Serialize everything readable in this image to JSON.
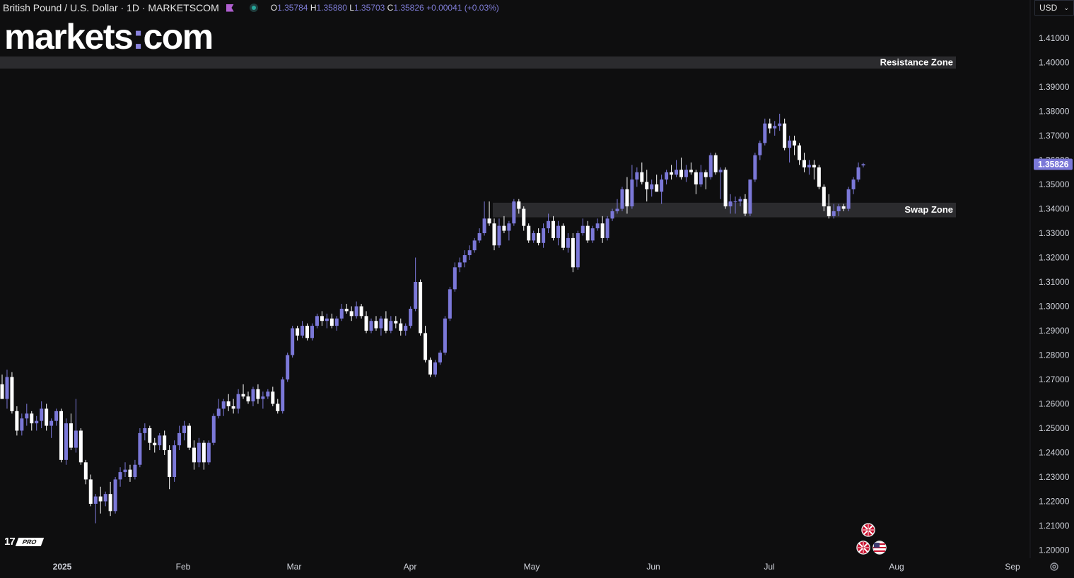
{
  "header": {
    "symbol": "British Pound / U.S. Dollar · 1D · MARKETSCOM",
    "open_label": "O",
    "open": "1.35784",
    "high_label": "H",
    "high": "1.35880",
    "low_label": "L",
    "low": "1.35703",
    "close_label": "C",
    "close": "1.35826",
    "change": "+0.00041 (+0.03%)"
  },
  "logo": {
    "part1": "markets",
    "part2": "com"
  },
  "currency_selector": {
    "value": "USD",
    "icon": "chevron-down-icon"
  },
  "branding": {
    "tv": "17",
    "pro": "PRO"
  },
  "icons": {
    "settings": "gear-icon",
    "flag_uk": "uk-flag-icon",
    "flag_us": "us-flag-icon"
  },
  "colors": {
    "up": "#7b78d8",
    "down": "#ffffff",
    "background": "#0e0e0f",
    "zone": "#2b2b2e",
    "price_tag": "#7b78d8"
  },
  "chart_data": {
    "type": "candlestick",
    "y_ticks": [
      "1.20000",
      "1.21000",
      "1.22000",
      "1.23000",
      "1.24000",
      "1.25000",
      "1.26000",
      "1.27000",
      "1.28000",
      "1.29000",
      "1.30000",
      "1.31000",
      "1.32000",
      "1.33000",
      "1.34000",
      "1.35000",
      "1.36000",
      "1.37000",
      "1.38000",
      "1.39000",
      "1.40000",
      "1.41000"
    ],
    "ylim": [
      1.193,
      1.415
    ],
    "x_labels": [
      "2025",
      "Feb",
      "Mar",
      "Apr",
      "May",
      "Jun",
      "Jul",
      "Aug",
      "Sep"
    ],
    "current_price": "1.35826",
    "zones": [
      {
        "label": "Resistance Zone",
        "low": 1.3975,
        "high": 1.4025
      },
      {
        "label": "Swap Zone",
        "low": 1.3365,
        "high": 1.3425
      }
    ],
    "candles": [
      [
        1.268,
        1.272,
        1.262,
        1.262
      ],
      [
        1.262,
        1.274,
        1.258,
        1.271
      ],
      [
        1.271,
        1.273,
        1.256,
        1.257
      ],
      [
        1.257,
        1.259,
        1.247,
        1.249
      ],
      [
        1.249,
        1.256,
        1.247,
        1.254
      ],
      [
        1.254,
        1.26,
        1.251,
        1.256
      ],
      [
        1.256,
        1.257,
        1.249,
        1.252
      ],
      [
        1.252,
        1.255,
        1.249,
        1.253
      ],
      [
        1.253,
        1.261,
        1.25,
        1.258
      ],
      [
        1.258,
        1.26,
        1.249,
        1.251
      ],
      [
        1.251,
        1.254,
        1.246,
        1.253
      ],
      [
        1.253,
        1.258,
        1.251,
        1.257
      ],
      [
        1.257,
        1.258,
        1.236,
        1.237
      ],
      [
        1.237,
        1.254,
        1.235,
        1.252
      ],
      [
        1.252,
        1.256,
        1.241,
        1.242
      ],
      [
        1.242,
        1.262,
        1.24,
        1.249
      ],
      [
        1.249,
        1.25,
        1.235,
        1.236
      ],
      [
        1.236,
        1.237,
        1.227,
        1.229
      ],
      [
        1.229,
        1.231,
        1.218,
        1.219
      ],
      [
        1.219,
        1.223,
        1.211,
        1.222
      ],
      [
        1.222,
        1.226,
        1.215,
        1.22
      ],
      [
        1.22,
        1.224,
        1.218,
        1.223
      ],
      [
        1.223,
        1.228,
        1.214,
        1.216
      ],
      [
        1.216,
        1.23,
        1.215,
        1.229
      ],
      [
        1.229,
        1.234,
        1.226,
        1.232
      ],
      [
        1.232,
        1.236,
        1.23,
        1.233
      ],
      [
        1.233,
        1.235,
        1.228,
        1.23
      ],
      [
        1.23,
        1.237,
        1.229,
        1.235
      ],
      [
        1.235,
        1.25,
        1.234,
        1.248
      ],
      [
        1.248,
        1.252,
        1.245,
        1.25
      ],
      [
        1.25,
        1.251,
        1.241,
        1.244
      ],
      [
        1.244,
        1.246,
        1.24,
        1.243
      ],
      [
        1.243,
        1.248,
        1.241,
        1.247
      ],
      [
        1.247,
        1.249,
        1.239,
        1.241
      ],
      [
        1.241,
        1.243,
        1.225,
        1.23
      ],
      [
        1.23,
        1.245,
        1.228,
        1.243
      ],
      [
        1.243,
        1.251,
        1.241,
        1.248
      ],
      [
        1.248,
        1.253,
        1.245,
        1.251
      ],
      [
        1.251,
        1.252,
        1.241,
        1.242
      ],
      [
        1.242,
        1.245,
        1.233,
        1.236
      ],
      [
        1.236,
        1.246,
        1.234,
        1.244
      ],
      [
        1.244,
        1.245,
        1.233,
        1.236
      ],
      [
        1.236,
        1.245,
        1.235,
        1.244
      ],
      [
        1.244,
        1.256,
        1.243,
        1.255
      ],
      [
        1.255,
        1.262,
        1.254,
        1.258
      ],
      [
        1.258,
        1.262,
        1.255,
        1.261
      ],
      [
        1.261,
        1.264,
        1.257,
        1.259
      ],
      [
        1.259,
        1.262,
        1.256,
        1.258
      ],
      [
        1.258,
        1.266,
        1.256,
        1.264
      ],
      [
        1.264,
        1.268,
        1.262,
        1.263
      ],
      [
        1.263,
        1.265,
        1.26,
        1.261
      ],
      [
        1.261,
        1.267,
        1.259,
        1.266
      ],
      [
        1.266,
        1.268,
        1.26,
        1.262
      ],
      [
        1.262,
        1.265,
        1.258,
        1.263
      ],
      [
        1.263,
        1.266,
        1.262,
        1.265
      ],
      [
        1.265,
        1.267,
        1.259,
        1.26
      ],
      [
        1.26,
        1.262,
        1.256,
        1.257
      ],
      [
        1.257,
        1.271,
        1.256,
        1.27
      ],
      [
        1.27,
        1.281,
        1.269,
        1.28
      ],
      [
        1.28,
        1.292,
        1.279,
        1.291
      ],
      [
        1.291,
        1.292,
        1.286,
        1.288
      ],
      [
        1.288,
        1.294,
        1.287,
        1.292
      ],
      [
        1.292,
        1.293,
        1.286,
        1.287
      ],
      [
        1.287,
        1.293,
        1.286,
        1.292
      ],
      [
        1.292,
        1.297,
        1.291,
        1.296
      ],
      [
        1.296,
        1.298,
        1.292,
        1.294
      ],
      [
        1.294,
        1.297,
        1.291,
        1.295
      ],
      [
        1.295,
        1.297,
        1.291,
        1.292
      ],
      [
        1.292,
        1.296,
        1.29,
        1.295
      ],
      [
        1.295,
        1.301,
        1.294,
        1.299
      ],
      [
        1.299,
        1.301,
        1.297,
        1.298
      ],
      [
        1.298,
        1.3,
        1.294,
        1.296
      ],
      [
        1.296,
        1.302,
        1.295,
        1.3
      ],
      [
        1.3,
        1.301,
        1.295,
        1.296
      ],
      [
        1.296,
        1.298,
        1.289,
        1.29
      ],
      [
        1.29,
        1.295,
        1.289,
        1.294
      ],
      [
        1.294,
        1.296,
        1.29,
        1.291
      ],
      [
        1.291,
        1.296,
        1.288,
        1.295
      ],
      [
        1.295,
        1.298,
        1.289,
        1.29
      ],
      [
        1.29,
        1.296,
        1.289,
        1.294
      ],
      [
        1.294,
        1.296,
        1.291,
        1.293
      ],
      [
        1.293,
        1.295,
        1.288,
        1.29
      ],
      [
        1.29,
        1.293,
        1.288,
        1.292
      ],
      [
        1.292,
        1.3,
        1.291,
        1.299
      ],
      [
        1.299,
        1.32,
        1.298,
        1.31
      ],
      [
        1.31,
        1.311,
        1.288,
        1.289
      ],
      [
        1.289,
        1.292,
        1.277,
        1.278
      ],
      [
        1.278,
        1.279,
        1.271,
        1.272
      ],
      [
        1.272,
        1.278,
        1.271,
        1.277
      ],
      [
        1.277,
        1.282,
        1.276,
        1.281
      ],
      [
        1.281,
        1.296,
        1.28,
        1.295
      ],
      [
        1.295,
        1.308,
        1.294,
        1.307
      ],
      [
        1.307,
        1.318,
        1.306,
        1.316
      ],
      [
        1.316,
        1.32,
        1.314,
        1.318
      ],
      [
        1.318,
        1.323,
        1.316,
        1.321
      ],
      [
        1.321,
        1.325,
        1.319,
        1.323
      ],
      [
        1.323,
        1.328,
        1.322,
        1.327
      ],
      [
        1.327,
        1.332,
        1.326,
        1.33
      ],
      [
        1.33,
        1.343,
        1.329,
        1.336
      ],
      [
        1.336,
        1.343,
        1.333,
        1.334
      ],
      [
        1.334,
        1.336,
        1.323,
        1.325
      ],
      [
        1.325,
        1.336,
        1.324,
        1.333
      ],
      [
        1.333,
        1.337,
        1.33,
        1.331
      ],
      [
        1.331,
        1.335,
        1.327,
        1.334
      ],
      [
        1.334,
        1.344,
        1.333,
        1.343
      ],
      [
        1.343,
        1.344,
        1.338,
        1.34
      ],
      [
        1.34,
        1.341,
        1.331,
        1.333
      ],
      [
        1.333,
        1.334,
        1.326,
        1.327
      ],
      [
        1.327,
        1.331,
        1.326,
        1.33
      ],
      [
        1.33,
        1.332,
        1.325,
        1.326
      ],
      [
        1.326,
        1.334,
        1.324,
        1.332
      ],
      [
        1.332,
        1.338,
        1.33,
        1.335
      ],
      [
        1.335,
        1.337,
        1.327,
        1.328
      ],
      [
        1.328,
        1.335,
        1.325,
        1.333
      ],
      [
        1.333,
        1.334,
        1.323,
        1.324
      ],
      [
        1.324,
        1.33,
        1.322,
        1.328
      ],
      [
        1.328,
        1.33,
        1.314,
        1.316
      ],
      [
        1.316,
        1.331,
        1.315,
        1.33
      ],
      [
        1.33,
        1.336,
        1.329,
        1.333
      ],
      [
        1.333,
        1.335,
        1.326,
        1.327
      ],
      [
        1.327,
        1.333,
        1.326,
        1.332
      ],
      [
        1.332,
        1.336,
        1.331,
        1.334
      ],
      [
        1.334,
        1.337,
        1.326,
        1.328
      ],
      [
        1.328,
        1.337,
        1.327,
        1.336
      ],
      [
        1.336,
        1.34,
        1.335,
        1.339
      ],
      [
        1.339,
        1.344,
        1.338,
        1.34
      ],
      [
        1.34,
        1.349,
        1.339,
        1.348
      ],
      [
        1.348,
        1.353,
        1.338,
        1.341
      ],
      [
        1.341,
        1.358,
        1.34,
        1.352
      ],
      [
        1.352,
        1.357,
        1.349,
        1.355
      ],
      [
        1.355,
        1.359,
        1.35,
        1.351
      ],
      [
        1.351,
        1.356,
        1.343,
        1.348
      ],
      [
        1.348,
        1.352,
        1.345,
        1.35
      ],
      [
        1.35,
        1.354,
        1.347,
        1.347
      ],
      [
        1.347,
        1.354,
        1.342,
        1.352
      ],
      [
        1.352,
        1.356,
        1.35,
        1.355
      ],
      [
        1.355,
        1.358,
        1.352,
        1.354
      ],
      [
        1.354,
        1.36,
        1.353,
        1.356
      ],
      [
        1.356,
        1.361,
        1.352,
        1.353
      ],
      [
        1.353,
        1.358,
        1.351,
        1.356
      ],
      [
        1.356,
        1.359,
        1.354,
        1.355
      ],
      [
        1.355,
        1.356,
        1.346,
        1.35
      ],
      [
        1.35,
        1.358,
        1.349,
        1.355
      ],
      [
        1.355,
        1.356,
        1.348,
        1.353
      ],
      [
        1.353,
        1.363,
        1.352,
        1.362
      ],
      [
        1.362,
        1.363,
        1.354,
        1.355
      ],
      [
        1.355,
        1.357,
        1.344,
        1.356
      ],
      [
        1.356,
        1.357,
        1.34,
        1.341
      ],
      [
        1.341,
        1.346,
        1.338,
        1.343
      ],
      [
        1.343,
        1.345,
        1.338,
        1.343
      ],
      [
        1.343,
        1.345,
        1.341,
        1.344
      ],
      [
        1.344,
        1.346,
        1.337,
        1.338
      ],
      [
        1.338,
        1.352,
        1.337,
        1.352
      ],
      [
        1.352,
        1.363,
        1.351,
        1.362
      ],
      [
        1.362,
        1.368,
        1.36,
        1.367
      ],
      [
        1.367,
        1.377,
        1.366,
        1.375
      ],
      [
        1.375,
        1.377,
        1.371,
        1.373
      ],
      [
        1.373,
        1.376,
        1.37,
        1.374
      ],
      [
        1.374,
        1.379,
        1.372,
        1.375
      ],
      [
        1.375,
        1.377,
        1.364,
        1.365
      ],
      [
        1.365,
        1.37,
        1.359,
        1.368
      ],
      [
        1.368,
        1.37,
        1.362,
        1.366
      ],
      [
        1.366,
        1.367,
        1.358,
        1.36
      ],
      [
        1.36,
        1.363,
        1.355,
        1.357
      ],
      [
        1.357,
        1.36,
        1.354,
        1.358
      ],
      [
        1.358,
        1.36,
        1.352,
        1.357
      ],
      [
        1.357,
        1.358,
        1.348,
        1.349
      ],
      [
        1.349,
        1.35,
        1.339,
        1.341
      ],
      [
        1.341,
        1.346,
        1.336,
        1.337
      ],
      [
        1.337,
        1.342,
        1.336,
        1.339
      ],
      [
        1.339,
        1.342,
        1.337,
        1.341
      ],
      [
        1.341,
        1.342,
        1.339,
        1.34
      ],
      [
        1.34,
        1.349,
        1.339,
        1.348
      ],
      [
        1.348,
        1.353,
        1.346,
        1.352
      ],
      [
        1.352,
        1.359,
        1.351,
        1.357
      ],
      [
        1.3578,
        1.3588,
        1.357,
        1.3583
      ]
    ]
  }
}
